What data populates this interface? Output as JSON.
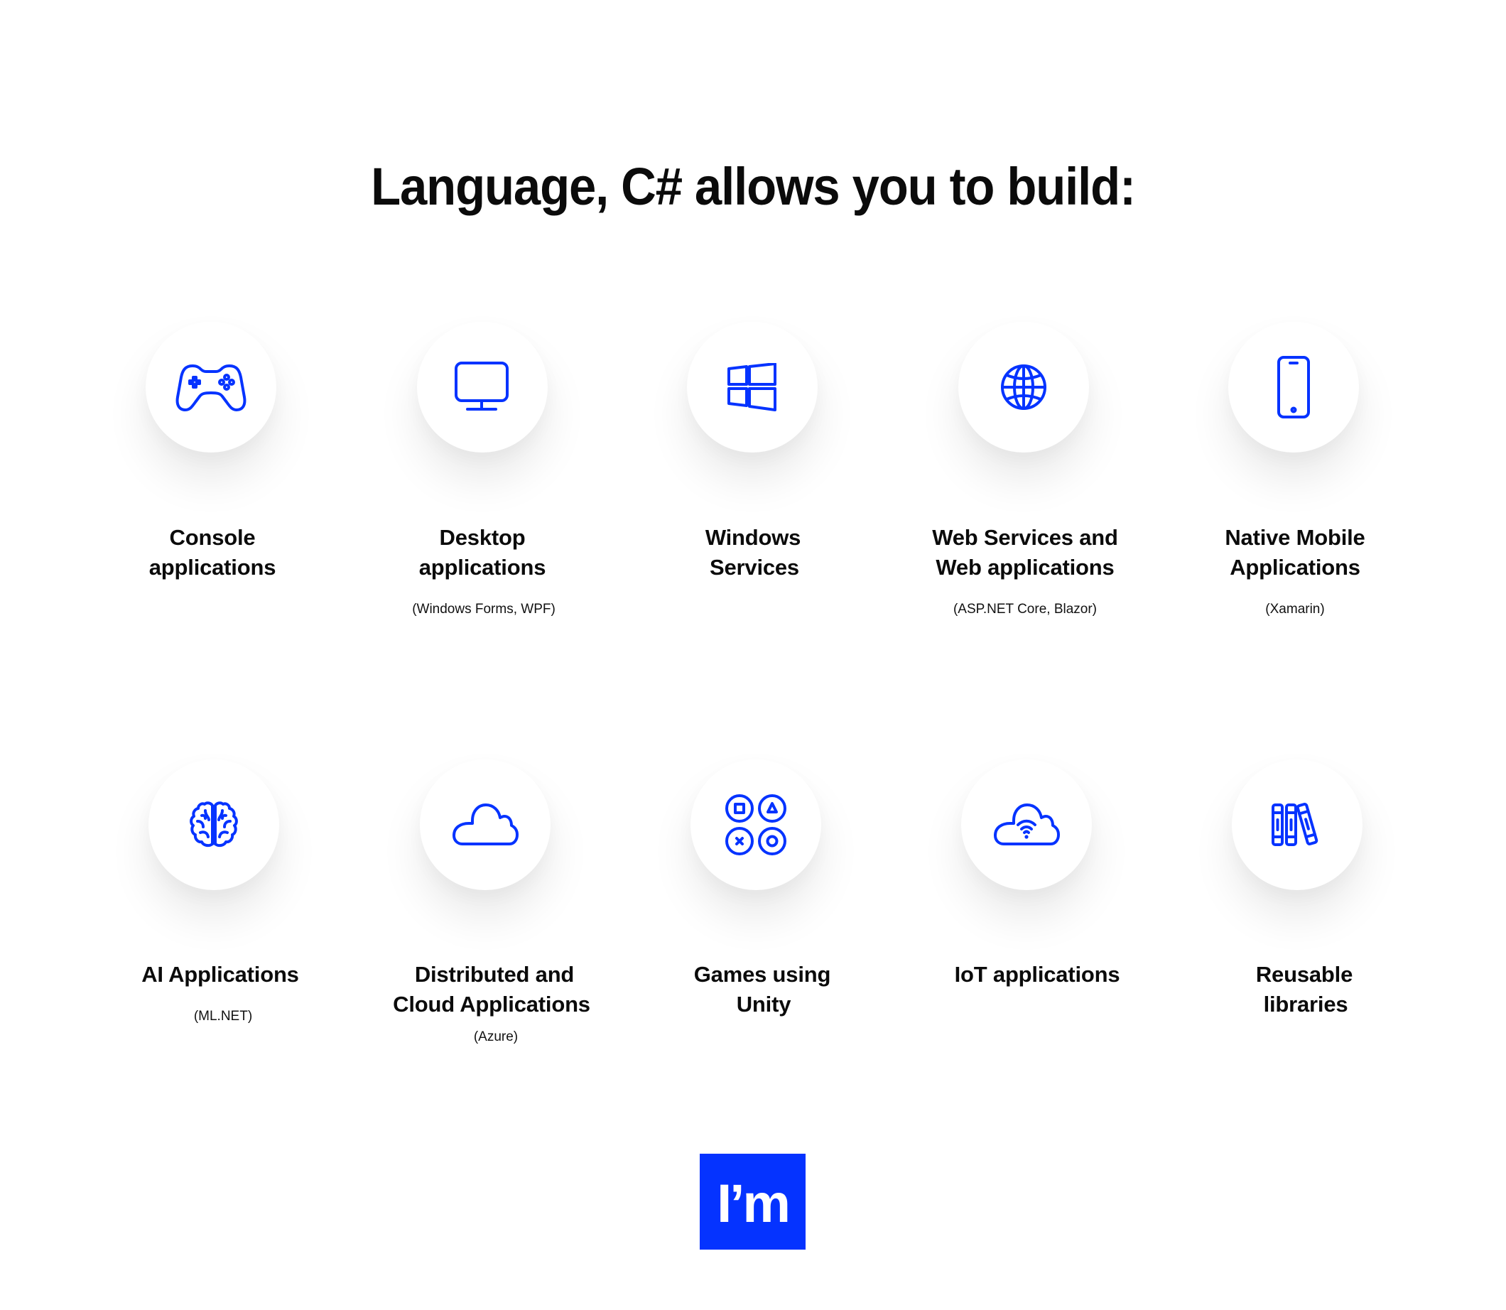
{
  "page": {
    "title": "Language, C# allows you to build:",
    "accent_color": "#0533ff"
  },
  "items": [
    {
      "icon": "gamepad-icon",
      "label_lines": [
        "Console",
        "applications"
      ],
      "sublabel": ""
    },
    {
      "icon": "monitor-icon",
      "label_lines": [
        "Desktop",
        "applications"
      ],
      "sublabel": "(Windows Forms, WPF)"
    },
    {
      "icon": "windows-logo-icon",
      "label_lines": [
        "Windows",
        "Services"
      ],
      "sublabel": ""
    },
    {
      "icon": "globe-icon",
      "label_lines": [
        "Web Services and",
        "Web applications"
      ],
      "sublabel": "(ASP.NET Core, Blazor)"
    },
    {
      "icon": "smartphone-icon",
      "label_lines": [
        "Native Mobile",
        "Applications"
      ],
      "sublabel": "(Xamarin)"
    },
    {
      "icon": "brain-icon",
      "label_lines": [
        "AI Applications"
      ],
      "sublabel": "(ML.NET)"
    },
    {
      "icon": "cloud-icon",
      "label_lines": [
        "Distributed and",
        "Cloud Applications"
      ],
      "sublabel": "(Azure)"
    },
    {
      "icon": "game-buttons-icon",
      "label_lines": [
        "Games using",
        "Unity"
      ],
      "sublabel": ""
    },
    {
      "icon": "cloud-wifi-icon",
      "label_lines": [
        "IoT applications"
      ],
      "sublabel": ""
    },
    {
      "icon": "books-icon",
      "label_lines": [
        "Reusable",
        "libraries"
      ],
      "sublabel": ""
    }
  ],
  "logo": {
    "text": "I’m"
  }
}
